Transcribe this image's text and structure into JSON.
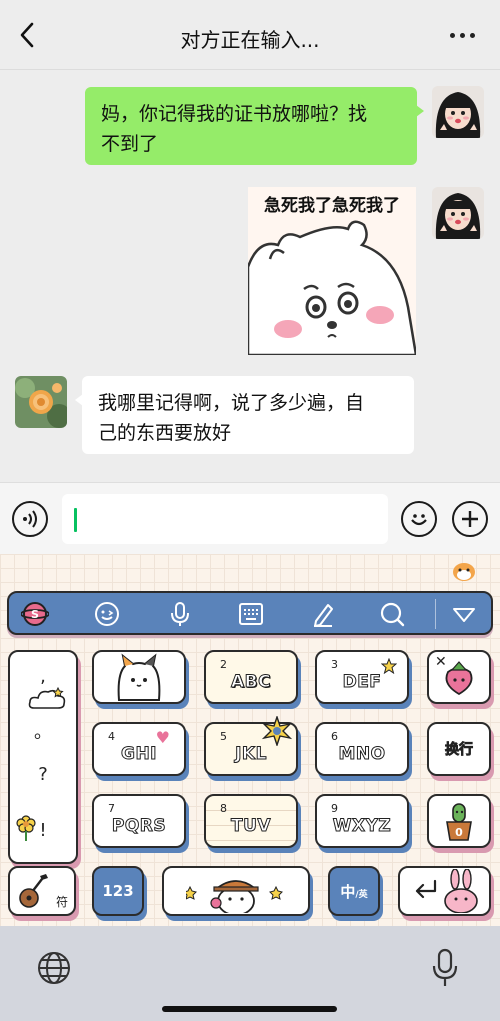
{
  "header": {
    "title": "对方正在输入...",
    "back_icon": "chevron-left-icon",
    "more_icon": "more-dots-icon"
  },
  "messages": [
    {
      "direction": "out",
      "type": "text",
      "text_line1": "妈，你记得我的证书放哪啦？找",
      "text_line2": "不到了"
    },
    {
      "direction": "out",
      "type": "sticker",
      "caption": "急死我了急死我了"
    },
    {
      "direction": "in",
      "type": "text",
      "text_line1": "我哪里记得啊，说了多少遍，自",
      "text_line2": "己的东西要放好"
    }
  ],
  "input_bar": {
    "voice_icon": "voice-icon",
    "emoji_icon": "emoji-icon",
    "add_icon": "plus-icon",
    "value": "",
    "caret_color": "#07c160"
  },
  "keyboard": {
    "toolbar_icons": [
      "sogou-logo-icon",
      "emoji-face-icon",
      "microphone-icon",
      "keyboard-icon",
      "pen-icon",
      "search-icon",
      "collapse-triangle-icon"
    ],
    "punct": [
      ",",
      "。",
      "?",
      "!"
    ],
    "keys": [
      {
        "num": "2",
        "label": "ABC"
      },
      {
        "num": "3",
        "label": "DEF"
      },
      {
        "num": "4",
        "label": "GHI"
      },
      {
        "num": "5",
        "label": "JKL"
      },
      {
        "num": "6",
        "label": "MNO"
      },
      {
        "num": "7",
        "label": "PQRS"
      },
      {
        "num": "8",
        "label": "TUV"
      },
      {
        "num": "9",
        "label": "WXYZ"
      }
    ],
    "newline_label": "换行",
    "symbol_label": "符",
    "num_label": "123",
    "lang_main": "中",
    "lang_alt": "/英"
  },
  "bottom": {
    "globe_icon": "globe-icon",
    "mic_icon": "dictation-mic-icon"
  },
  "colors": {
    "self_bubble": "#95ec69",
    "other_bubble": "#ffffff",
    "keyboard_accent": "#5a83ba",
    "keyboard_shadow_pink": "#d99ab0"
  }
}
